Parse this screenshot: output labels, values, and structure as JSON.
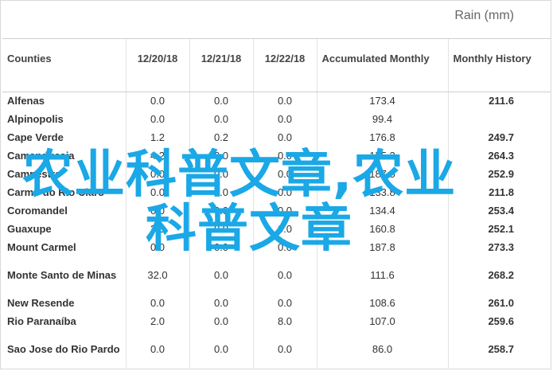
{
  "title": "Rain (mm)",
  "columns": [
    "Counties",
    "12/20/18",
    "12/21/18",
    "12/22/18",
    "Accumulated Monthly",
    "Monthly History"
  ],
  "rows": [
    {
      "county": "Alfenas",
      "d1": "0.0",
      "d2": "0.0",
      "d3": "0.0",
      "acc": "173.4",
      "hist": "211.6"
    },
    {
      "county": "Alpinopolis",
      "d1": "0.0",
      "d2": "0.0",
      "d3": "0.0",
      "acc": "99.4",
      "hist": ""
    },
    {
      "county": "Cape Verde",
      "d1": "1.2",
      "d2": "0.2",
      "d3": "0.0",
      "acc": "176.8",
      "hist": "249.7"
    },
    {
      "county": "Camanducaia",
      "d1": "4.2",
      "d2": "0.0",
      "d3": "0.0",
      "acc": "155.2",
      "hist": "264.3"
    },
    {
      "county": "Campestre",
      "d1": "0.0",
      "d2": "0.0",
      "d3": "0.0",
      "acc": "187.5",
      "hist": "252.9"
    },
    {
      "county": "Carmo do Rio Claro",
      "d1": "0.0",
      "d2": "0.0",
      "d3": "0.0",
      "acc": "133.8",
      "hist": "211.8"
    },
    {
      "county": "Coromandel",
      "d1": "0.0",
      "d2": "0.0",
      "d3": "0.0",
      "acc": "134.4",
      "hist": "253.4"
    },
    {
      "county": "Guaxupe",
      "d1": "3.6",
      "d2": "0.0",
      "d3": "0.0",
      "acc": "160.8",
      "hist": "252.1"
    },
    {
      "county": "Mount Carmel",
      "d1": "0.0",
      "d2": "0.0",
      "d3": "0.0",
      "acc": "187.8",
      "hist": "273.3"
    },
    {
      "county": "Monte Santo de Minas",
      "d1": "32.0",
      "d2": "0.0",
      "d3": "0.0",
      "acc": "111.6",
      "hist": "268.2"
    },
    {
      "county": "New Resende",
      "d1": "0.0",
      "d2": "0.0",
      "d3": "0.0",
      "acc": "108.6",
      "hist": "261.0"
    },
    {
      "county": "Rio Paranaíba",
      "d1": "2.0",
      "d2": "0.0",
      "d3": "8.0",
      "acc": "107.0",
      "hist": "259.6"
    },
    {
      "county": "Sao Jose do Rio Pardo",
      "d1": "0.0",
      "d2": "0.0",
      "d3": "0.0",
      "acc": "86.0",
      "hist": "258.7"
    }
  ],
  "watermark": {
    "line1": "农业科普文章,农业",
    "line2": "科普文章"
  }
}
